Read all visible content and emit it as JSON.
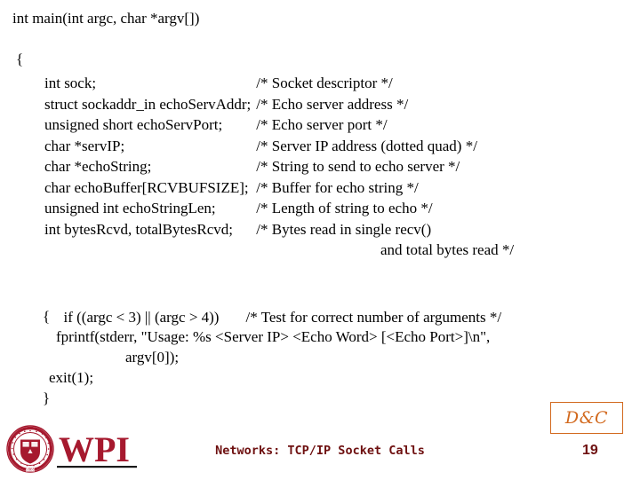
{
  "slide": {
    "code": {
      "signature": "int main(int argc, char *argv[])",
      "brace_open": "{",
      "declarations": [
        {
          "decl": "int sock;",
          "comment": "/* Socket descriptor */"
        },
        {
          "decl": "struct sockaddr_in echoServAddr;",
          "comment": "/* Echo server address */"
        },
        {
          "decl": "unsigned short echoServPort;",
          "comment": "/* Echo server port */"
        },
        {
          "decl": "char *servIP;",
          "comment": "/* Server IP address (dotted quad) */"
        },
        {
          "decl": "char *echoString;",
          "comment": "/* String to send to echo server */"
        },
        {
          "decl": "char echoBuffer[RCVBUFSIZE];",
          "comment": "/* Buffer for echo string */"
        },
        {
          "decl": "unsigned int echoStringLen;",
          "comment": "/* Length of string to echo */"
        },
        {
          "decl": "int bytesRcvd, totalBytesRcvd;",
          "comment": "/* Bytes read in single recv()"
        }
      ],
      "comment_continuation": "and total bytes read */",
      "if_statement": "if ((argc < 3) || (argc > 4))",
      "if_comment": "/* Test for correct number of arguments */",
      "if_brace_open": "{",
      "fprintf_line": "fprintf(stderr, \"Usage: %s <Server IP> <Echo Word> [<Echo Port>]\\n\",",
      "argv_line": "argv[0]);",
      "exit_line": "exit(1);",
      "if_brace_close": "}"
    },
    "badge": {
      "label": "D&C",
      "color": "#D2691E"
    },
    "footer": {
      "title": "Networks: TCP/IP Socket Calls",
      "page_number": "19",
      "color": "#6E1010"
    },
    "logo": {
      "wordmark": "WPI",
      "seal_text_top": "WORCESTER POLYTECHNIC",
      "seal_text_bottom": "INSTITUTE",
      "seal_year": "1865",
      "color": "#A6192E"
    }
  }
}
